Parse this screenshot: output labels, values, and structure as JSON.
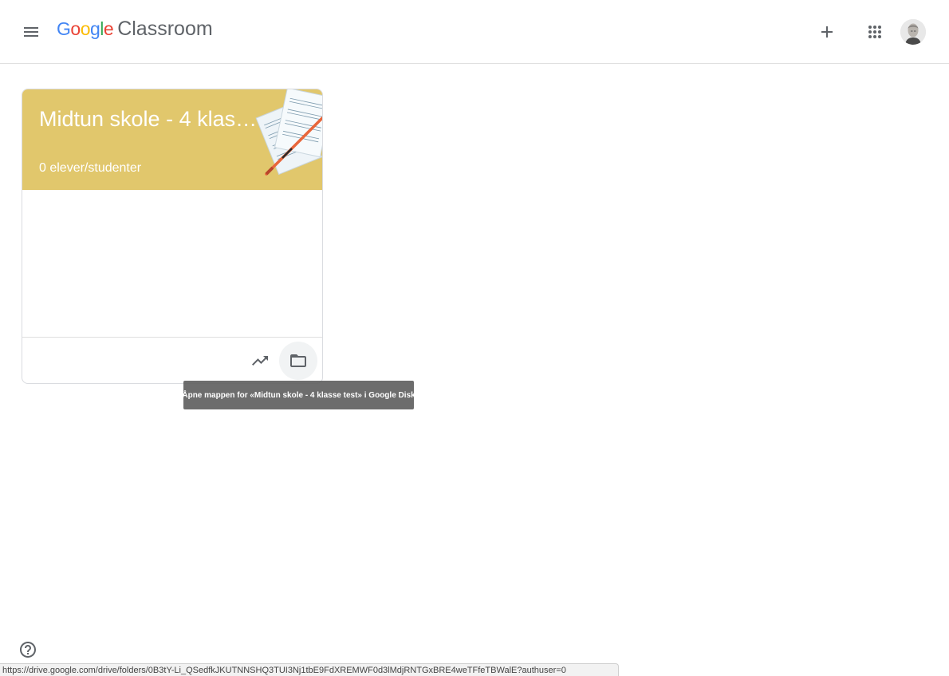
{
  "header": {
    "menu_icon": "hamburger-menu-icon",
    "logo_google_letters": [
      {
        "ch": "G",
        "color": "#4285F4"
      },
      {
        "ch": "o",
        "color": "#EA4335"
      },
      {
        "ch": "o",
        "color": "#FBBC05"
      },
      {
        "ch": "g",
        "color": "#4285F4"
      },
      {
        "ch": "l",
        "color": "#34A853"
      },
      {
        "ch": "e",
        "color": "#EA4335"
      }
    ],
    "logo_product": "Classroom",
    "add_icon": "plus-icon",
    "apps_icon": "apps-grid-icon",
    "avatar_icon": "user-avatar"
  },
  "class_card": {
    "title": "Midtun skole - 4 klasse test",
    "students": "0 elever/studenter",
    "header_color": "#e1c76c",
    "trend_icon": "trending-up-icon",
    "folder_icon": "folder-icon"
  },
  "tooltip": {
    "text": "Åpne mappen for «Midtun skole - 4 klasse test» i Google Disk"
  },
  "help": {
    "icon": "help-circle-icon"
  },
  "status_bar": {
    "url": "https://drive.google.com/drive/folders/0B3tY-Li_QSedfkJKUTNNSHQ3TUI3Nj1tbE9FdXREMWF0d3lMdjRNTGxBRE4weTFfeTBWalE?authuser=0"
  }
}
